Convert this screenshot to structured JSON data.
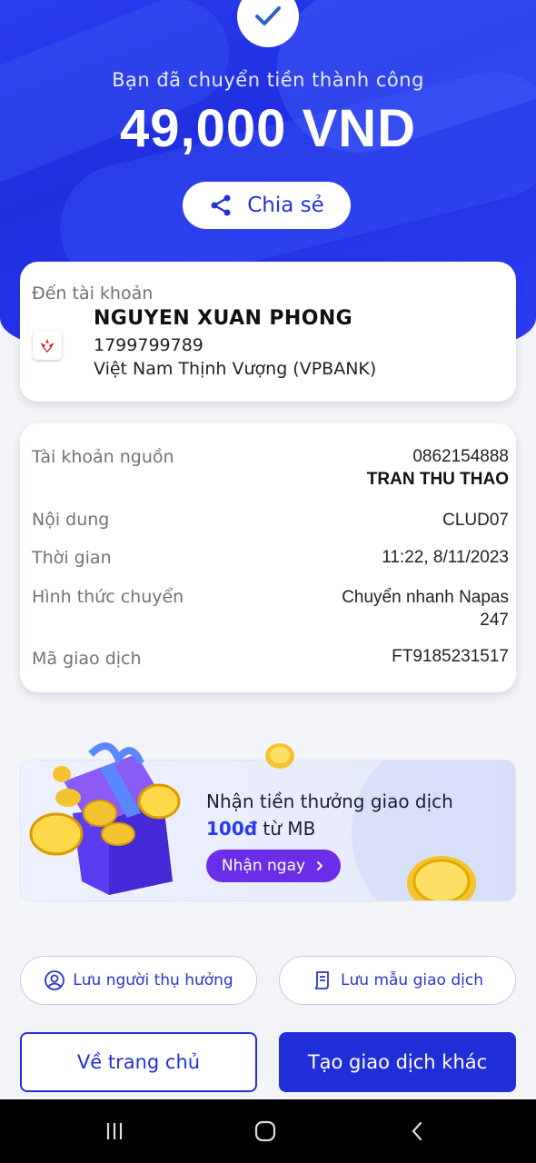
{
  "header": {
    "success_text": "Bạn đã chuyển tiền thành công",
    "amount": "49,000 VND",
    "share_label": "Chia sẻ"
  },
  "recipient": {
    "label": "Đến tài khoản",
    "name": "NGUYEN XUAN PHONG",
    "account_number": "1799799789",
    "bank": "Việt Nam Thịnh Vượng (VPBANK)"
  },
  "details": [
    {
      "label": "Tài khoản nguồn",
      "value": "0862154888",
      "value2": "TRAN THU THAO"
    },
    {
      "label": "Nội dung",
      "value": "CLUD07"
    },
    {
      "label": "Thời gian",
      "value": "11:22, 8/11/2023"
    },
    {
      "label": "Hình thức chuyển",
      "value": "Chuyển nhanh Napas",
      "value2": "247"
    },
    {
      "label": "Mã giao dịch",
      "value": "FT9185231517"
    }
  ],
  "promo": {
    "text_before": "Nhận tiền thưởng giao dịch ",
    "highlight": "100đ",
    "text_after": " từ MB",
    "button_label": "Nhận ngay"
  },
  "actions": {
    "save_beneficiary": "Lưu người thụ hưởng",
    "save_template": "Lưu mẫu giao dịch",
    "home": "Về trang chủ",
    "new_transaction": "Tạo giao dịch khác"
  },
  "colors": {
    "brand_blue": "#1f2ed6",
    "promo_purple": "#6a2ee8",
    "vpbank_red": "#d71920"
  },
  "icons": [
    "check-icon",
    "share-icon",
    "vpbank-logo",
    "user-circle-icon",
    "receipt-icon",
    "chevron-right-icon",
    "recent-apps-icon",
    "home-icon",
    "back-icon"
  ]
}
